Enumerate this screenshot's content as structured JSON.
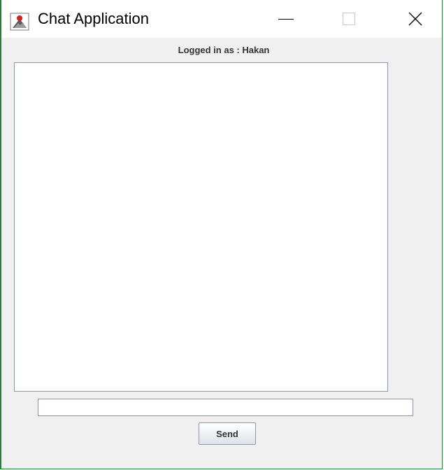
{
  "window": {
    "title": "Chat Application",
    "icon": "java-cup-icon",
    "controls": [
      "minimize-icon",
      "maximize-icon",
      "close-icon"
    ]
  },
  "header": {
    "logged_in_text": "Logged in as : Hakan"
  },
  "chat": {
    "messages": []
  },
  "input": {
    "value": ""
  },
  "send": {
    "label": "Send"
  },
  "colors": {
    "window_border": "#2d7d3a",
    "panel_background": "#f0f0f0",
    "field_border": "#8e97a4"
  }
}
